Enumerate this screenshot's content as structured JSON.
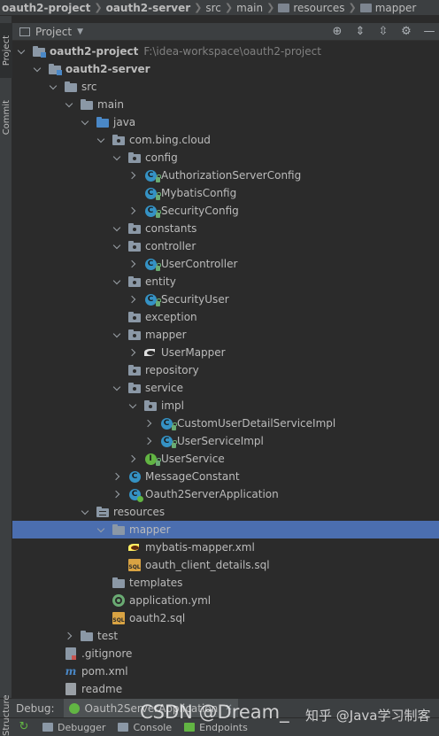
{
  "breadcrumb": [
    {
      "label": "oauth2-project",
      "bold": true
    },
    {
      "label": "oauth2-server",
      "bold": true
    },
    {
      "label": "src",
      "bold": false
    },
    {
      "label": "main",
      "bold": false
    },
    {
      "label": "resources",
      "bold": false
    },
    {
      "label": "mapper",
      "bold": false
    }
  ],
  "toolstrip": {
    "project_tab": "Project",
    "commit_tab": "Commit",
    "structure_tab": "Structure"
  },
  "project_panel": {
    "title": "Project",
    "tools": [
      "crosshair-icon",
      "expand-all-icon",
      "collapse-all-icon",
      "gear-icon",
      "minimize-icon"
    ]
  },
  "tree": [
    {
      "label": "oauth2-project",
      "path": "F:\\idea-workspace\\oauth2-project",
      "bold": true,
      "depth": 0,
      "arrow": "down",
      "icon": "module-folder"
    },
    {
      "label": "oauth2-server",
      "bold": true,
      "depth": 1,
      "arrow": "down",
      "icon": "module-folder"
    },
    {
      "label": "src",
      "depth": 2,
      "arrow": "down",
      "icon": "folder"
    },
    {
      "label": "main",
      "depth": 3,
      "arrow": "down",
      "icon": "folder"
    },
    {
      "label": "java",
      "depth": 4,
      "arrow": "down",
      "icon": "blue-folder"
    },
    {
      "label": "com.bing.cloud",
      "depth": 5,
      "arrow": "down",
      "icon": "package"
    },
    {
      "label": "config",
      "depth": 6,
      "arrow": "down",
      "icon": "package"
    },
    {
      "label": "AuthorizationServerConfig",
      "depth": 7,
      "arrow": "right",
      "icon": "class"
    },
    {
      "label": "MybatisConfig",
      "depth": 7,
      "arrow": "none",
      "icon": "class"
    },
    {
      "label": "SecurityConfig",
      "depth": 7,
      "arrow": "right",
      "icon": "class"
    },
    {
      "label": "constants",
      "depth": 6,
      "arrow": "down",
      "icon": "package"
    },
    {
      "label": "controller",
      "depth": 6,
      "arrow": "down",
      "icon": "package"
    },
    {
      "label": "UserController",
      "depth": 7,
      "arrow": "right",
      "icon": "class"
    },
    {
      "label": "entity",
      "depth": 6,
      "arrow": "down",
      "icon": "package"
    },
    {
      "label": "SecurityUser",
      "depth": 7,
      "arrow": "right",
      "icon": "class"
    },
    {
      "label": "exception",
      "depth": 6,
      "arrow": "none",
      "icon": "package"
    },
    {
      "label": "mapper",
      "depth": 6,
      "arrow": "down",
      "icon": "package"
    },
    {
      "label": "UserMapper",
      "depth": 7,
      "arrow": "right",
      "icon": "mybatis"
    },
    {
      "label": "repository",
      "depth": 6,
      "arrow": "none",
      "icon": "package"
    },
    {
      "label": "service",
      "depth": 6,
      "arrow": "down",
      "icon": "package"
    },
    {
      "label": "impl",
      "depth": 7,
      "arrow": "down",
      "icon": "package"
    },
    {
      "label": "CustomUserDetailServiceImpl",
      "depth": 8,
      "arrow": "right",
      "icon": "class"
    },
    {
      "label": "UserServiceImpl",
      "depth": 8,
      "arrow": "right",
      "icon": "class"
    },
    {
      "label": "UserService",
      "depth": 7,
      "arrow": "right",
      "icon": "interface"
    },
    {
      "label": "MessageConstant",
      "depth": 6,
      "arrow": "right",
      "icon": "class-plain"
    },
    {
      "label": "Oauth2ServerApplication",
      "depth": 6,
      "arrow": "right",
      "icon": "class-run"
    },
    {
      "label": "resources",
      "depth": 4,
      "arrow": "down",
      "icon": "resource-folder"
    },
    {
      "label": "mapper",
      "depth": 5,
      "arrow": "down",
      "icon": "folder",
      "selected": true
    },
    {
      "label": "mybatis-mapper.xml",
      "depth": 6,
      "arrow": "none",
      "icon": "xml"
    },
    {
      "label": "oauth_client_details.sql",
      "depth": 6,
      "arrow": "none",
      "icon": "sql"
    },
    {
      "label": "templates",
      "depth": 5,
      "arrow": "none",
      "icon": "folder"
    },
    {
      "label": "application.yml",
      "depth": 5,
      "arrow": "none",
      "icon": "yml"
    },
    {
      "label": "oauth2.sql",
      "depth": 5,
      "arrow": "none",
      "icon": "sql"
    },
    {
      "label": "test",
      "depth": 3,
      "arrow": "right",
      "icon": "folder"
    },
    {
      "label": ".gitignore",
      "depth": 2,
      "arrow": "none",
      "icon": "git"
    },
    {
      "label": "pom.xml",
      "depth": 2,
      "arrow": "none",
      "icon": "maven"
    },
    {
      "label": "readme",
      "depth": 2,
      "arrow": "none",
      "icon": "text"
    }
  ],
  "debug": {
    "label": "Debug:",
    "tab": "Oauth2ServerApplication"
  },
  "bottom_tabs": [
    "Debugger",
    "Console",
    "Endpoints"
  ],
  "watermark": {
    "left": "CSDN @Dream_",
    "right": "知乎 @Java学习制客"
  },
  "colors": {
    "selection": "#4b6eaf",
    "background": "#2b2b2b",
    "panel": "#3c3f41",
    "class_icon": "#3592c4",
    "interface_icon": "#62b543"
  }
}
